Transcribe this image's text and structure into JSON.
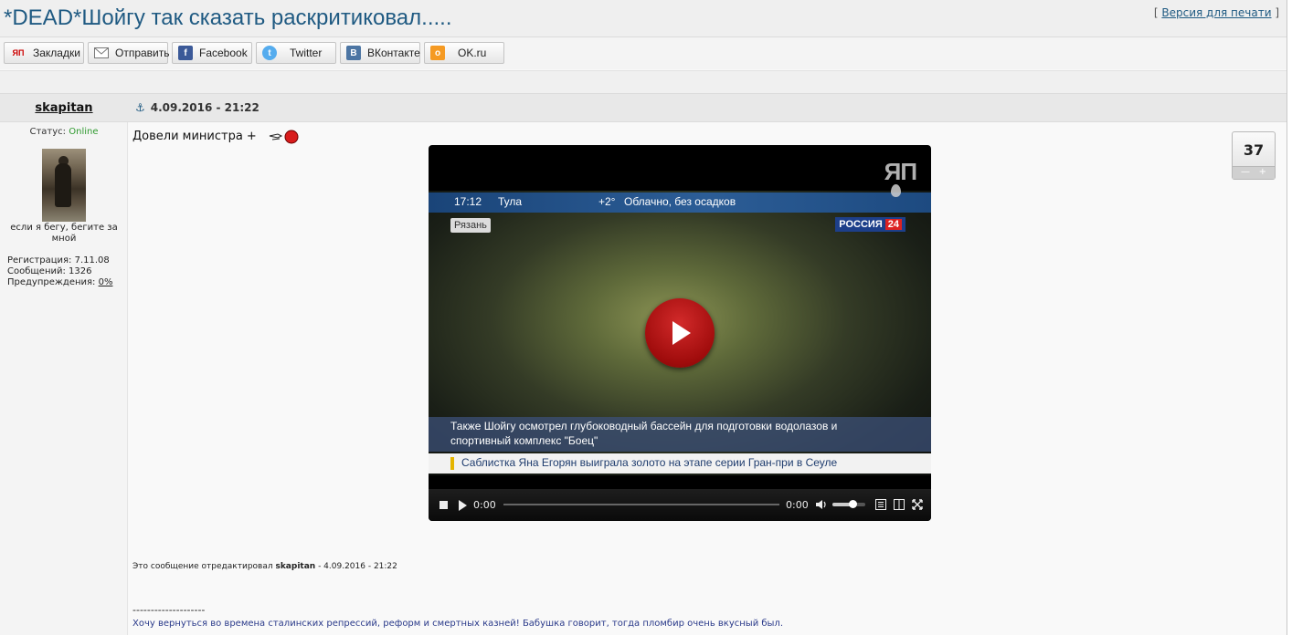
{
  "topic": {
    "title": "*DEAD*Шойгу так сказать раскритиковал.....",
    "print_prefix": "[ ",
    "print_link": "Версия для печати",
    "print_suffix": " ]"
  },
  "share": {
    "buttons": [
      {
        "label": "Закладки",
        "icon": "yap-icon",
        "color": "#ffffff"
      },
      {
        "label": "Отправить",
        "icon": "mail-icon",
        "color": "#ffffff"
      },
      {
        "label": "Facebook",
        "icon": "facebook-icon",
        "color": "#3b5998"
      },
      {
        "label": "Twitter",
        "icon": "twitter-icon",
        "color": "#55acee"
      },
      {
        "label": "ВКонтакте",
        "icon": "vk-icon",
        "color": "#4c75a3"
      },
      {
        "label": "OK.ru",
        "icon": "ok-icon",
        "color": "#f59a23"
      }
    ]
  },
  "post": {
    "author": "skapitan",
    "date": "4.09.2016 - 21:22",
    "status_label": "Статус: ",
    "status_value": "Online",
    "signature": "если я бегу, бегите за мной",
    "registration": "Регистрация: 7.11.08",
    "messages": "Сообщений: 1326",
    "warnings_label": "Предупреждения: ",
    "warnings_value": "0%",
    "text": "Довели министра +",
    "rating": "37",
    "edited_prefix": "Это сообщение отредактировал ",
    "edited_user": "skapitan",
    "edited_suffix": " - 4.09.2016 - 21:22",
    "dashes": "--------------------",
    "sig_line": "Хочу вернуться во времена сталинских репрессий, реформ и смертных казней! Бабушка говорит, тогда пломбир очень вкусный был."
  },
  "video": {
    "time": "17:12",
    "city": "Тула",
    "temp": "+2°",
    "weather": "Облачно, без осадков",
    "location": "Рязань",
    "channel": "РОССИЯ",
    "channel_num": "24",
    "watermark": "ЯП",
    "caption_line1": "Также Шойгу осмотрел глубоководный бассейн для подготовки водолазов и",
    "caption_line2": "спортивный комплекс \"Боец\"",
    "ticker": "Саблистка Яна Егорян выиграла золото на этапе серии Гран-при в Сеуле",
    "current_time": "0:00",
    "duration": "0:00",
    "progress": 0,
    "volume": 0.6
  }
}
